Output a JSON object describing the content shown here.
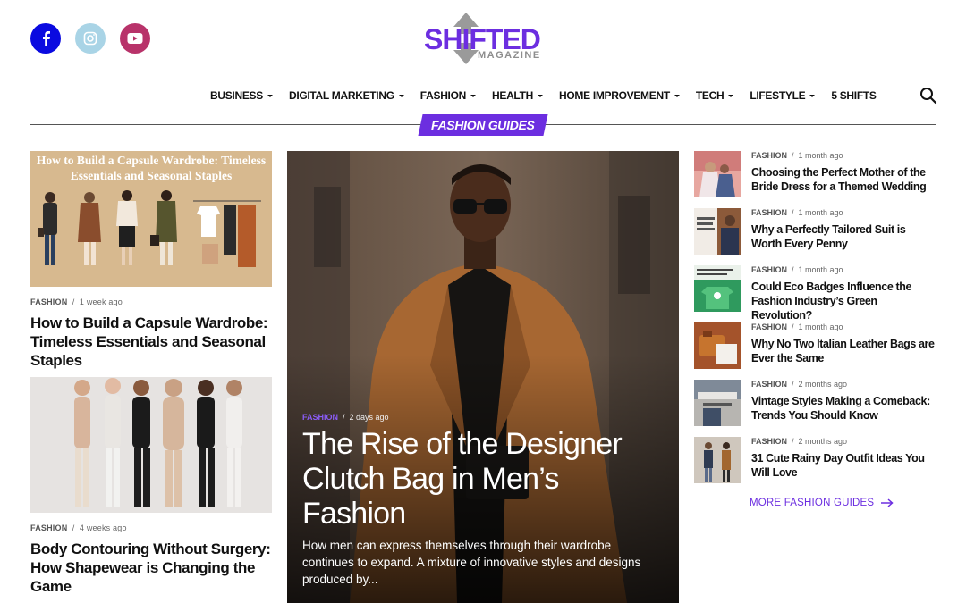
{
  "header": {
    "logo": {
      "main": "SHIFTED",
      "sub": "MAGAZINE"
    },
    "social": [
      {
        "name": "facebook",
        "icon": "facebook-icon",
        "color": "#0a0ae0"
      },
      {
        "name": "instagram",
        "icon": "instagram-icon",
        "color": "#a9d4e6"
      },
      {
        "name": "youtube",
        "icon": "youtube-icon",
        "color": "#b8336a"
      }
    ],
    "nav": [
      {
        "label": "BUSINESS",
        "dropdown": true
      },
      {
        "label": "DIGITAL MARKETING",
        "dropdown": true
      },
      {
        "label": "FASHION",
        "dropdown": true
      },
      {
        "label": "HEALTH",
        "dropdown": true
      },
      {
        "label": "HOME IMPROVEMENT",
        "dropdown": true
      },
      {
        "label": "TECH",
        "dropdown": true
      },
      {
        "label": "LIFESTYLE",
        "dropdown": true
      },
      {
        "label": "5 SHIFTS",
        "dropdown": false
      }
    ]
  },
  "section": {
    "title": "FASHION GUIDES",
    "accent": "#6c2ee0"
  },
  "left": [
    {
      "thumb_text": "How to Build a Capsule Wardrobe: Timeless Essentials and Seasonal Staples",
      "category": "FASHION",
      "time": "1 week ago",
      "title": "How to Build a Capsule Wardrobe: Timeless Essentials and Seasonal Staples"
    },
    {
      "category": "FASHION",
      "time": "4 weeks ago",
      "title": "Body Contouring Without Surgery: How Shapewear is Changing the Game"
    }
  ],
  "feature": {
    "category": "FASHION",
    "time": "2 days ago",
    "title": "The Rise of the Designer Clutch Bag in Men’s Fashion",
    "excerpt": "How men can express themselves through their wardrobe continues to expand. A mixture of innovative styles and designs produced by..."
  },
  "right": [
    {
      "category": "FASHION",
      "time": "1 month ago",
      "title": "Choosing the Perfect Mother of the Bride Dress for a Themed Wedding"
    },
    {
      "category": "FASHION",
      "time": "1 month ago",
      "title": "Why a Perfectly Tailored Suit is Worth Every Penny"
    },
    {
      "category": "FASHION",
      "time": "1 month ago",
      "title": "Could Eco Badges Influence the Fashion Industry’s Green Revolution?"
    },
    {
      "category": "FASHION",
      "time": "1 month ago",
      "title": "Why No Two Italian Leather Bags are Ever the Same"
    },
    {
      "category": "FASHION",
      "time": "2 months ago",
      "title": "Vintage Styles Making a Comeback: Trends You Should Know"
    },
    {
      "category": "FASHION",
      "time": "2 months ago",
      "title": "31 Cute Rainy Day Outfit Ideas You Will Love"
    }
  ],
  "more_link": "MORE FASHION GUIDES"
}
